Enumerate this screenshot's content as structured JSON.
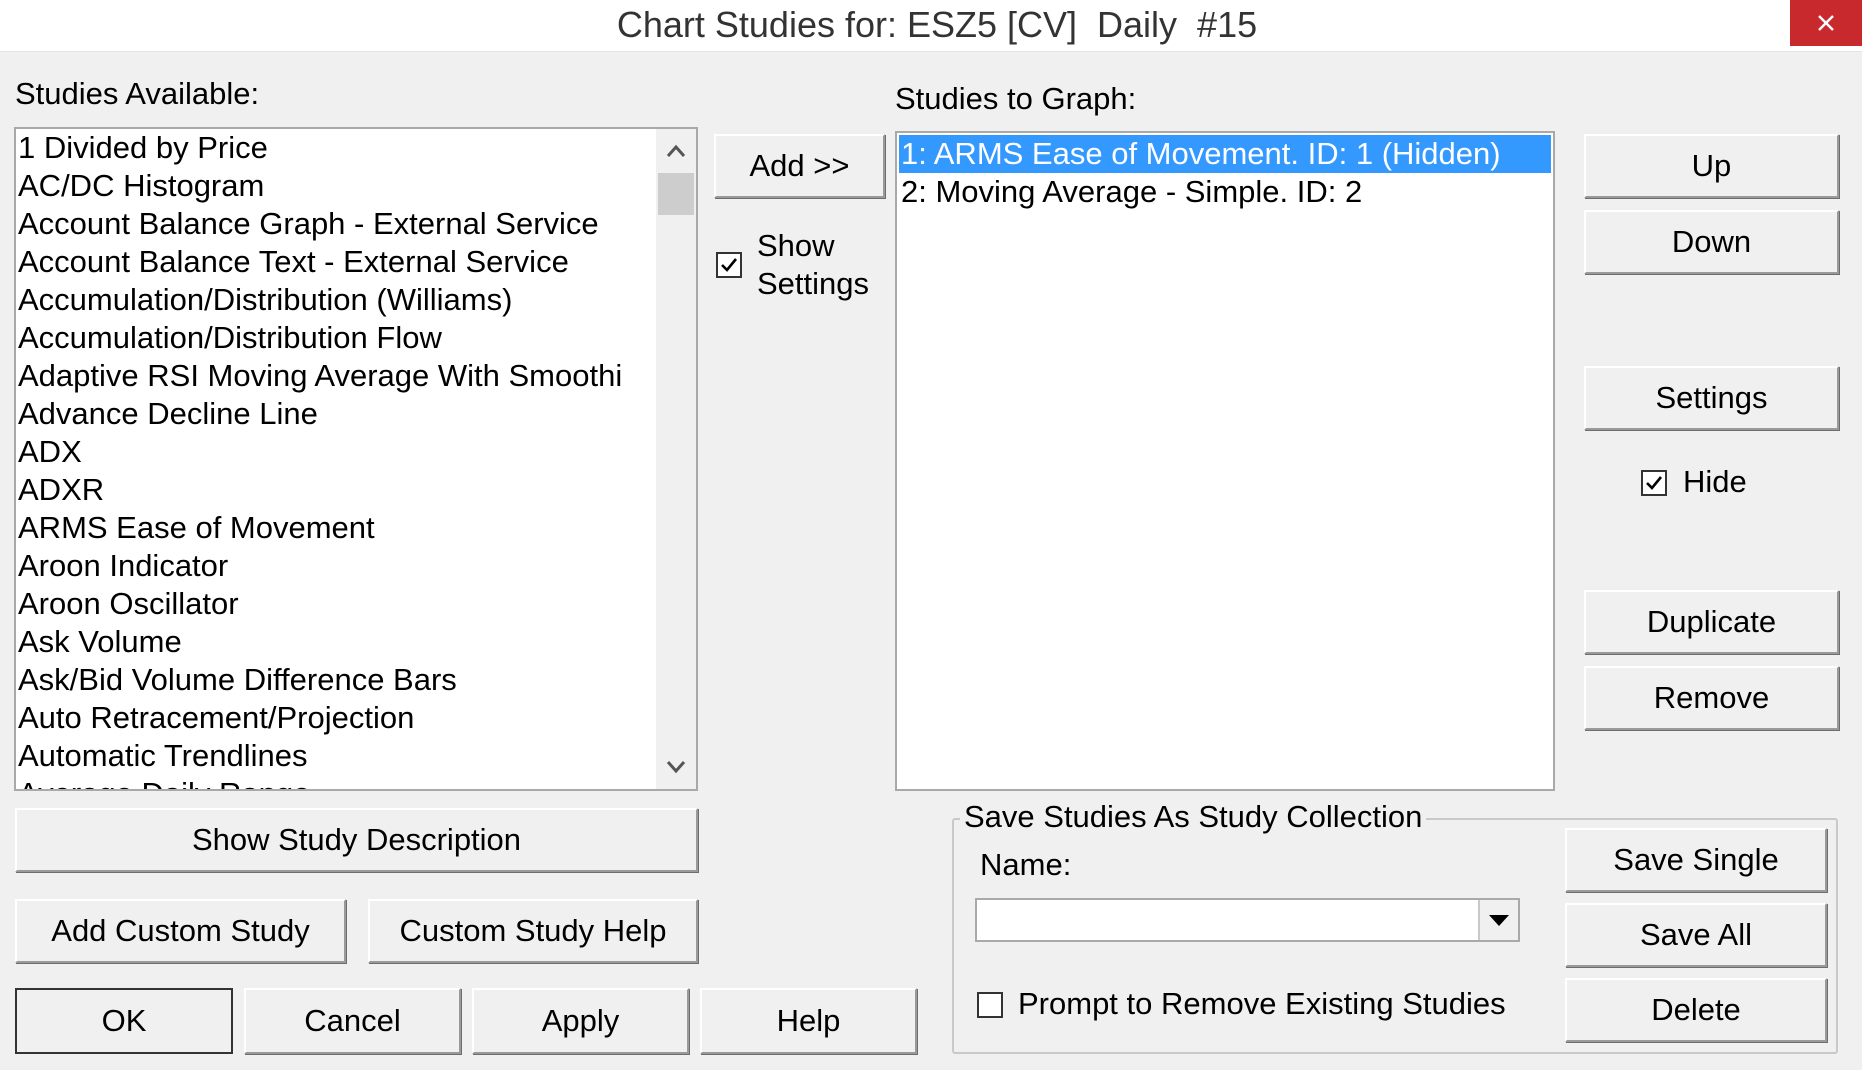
{
  "window": {
    "title": "Chart Studies for: ESZ5 [CV]  Daily  #15",
    "close_icon": "close-icon"
  },
  "available": {
    "label": "Studies Available:",
    "items": [
      "1 Divided by Price",
      "AC/DC Histogram",
      "Account Balance Graph - External Service",
      "Account Balance Text - External Service",
      "Accumulation/Distribution (Williams)",
      "Accumulation/Distribution Flow",
      "Adaptive RSI Moving Average With Smoothi",
      "Advance Decline Line",
      "ADX",
      "ADXR",
      "ARMS Ease of Movement",
      "Aroon Indicator",
      "Aroon Oscillator",
      "Ask Volume",
      "Ask/Bid Volume Difference Bars",
      "Auto Retracement/Projection",
      "Automatic Trendlines",
      "Average Daily Range"
    ]
  },
  "middle": {
    "add_label": "Add >>",
    "show_settings_line1": "Show",
    "show_settings_line2": "Settings",
    "show_settings_checked": true
  },
  "graph": {
    "label": "Studies to Graph:",
    "items": [
      "1: ARMS Ease of Movement. ID: 1 (Hidden)",
      "2: Moving Average - Simple. ID: 2"
    ],
    "selected_index": 0
  },
  "right_buttons": {
    "up": "Up",
    "down": "Down",
    "settings": "Settings",
    "hide_label": "Hide",
    "hide_checked": true,
    "duplicate": "Duplicate",
    "remove": "Remove"
  },
  "left_buttons": {
    "show_description": "Show Study Description",
    "add_custom": "Add Custom Study",
    "custom_help": "Custom Study Help"
  },
  "dialog_buttons": {
    "ok": "OK",
    "cancel": "Cancel",
    "apply": "Apply",
    "help": "Help"
  },
  "collection": {
    "group_label": "Save Studies As Study Collection",
    "name_label": "Name:",
    "name_value": "",
    "prompt_label": "Prompt to Remove Existing Studies",
    "prompt_checked": false,
    "save_single": "Save Single",
    "save_all": "Save All",
    "delete": "Delete"
  },
  "colors": {
    "selection": "#3399ff",
    "close_button": "#c7292d",
    "dialog_bg": "#f0f0f0"
  }
}
